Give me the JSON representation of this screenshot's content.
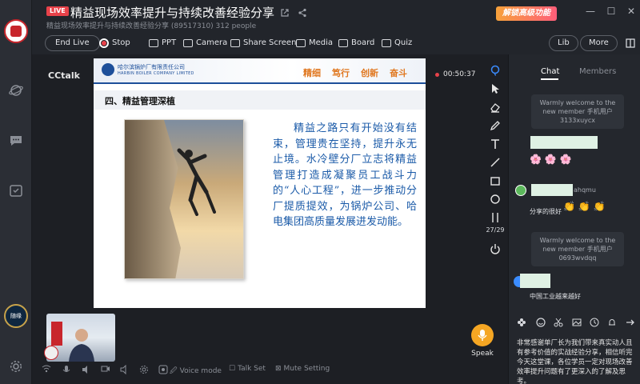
{
  "header": {
    "live_badge": "LIVE",
    "title": "精益现场效率提升与持续改善经验分享",
    "subtitle": "精益现场效率提升与持续改善经验分享 (89517310)   312 people",
    "unlock_label": "解锁高级功能"
  },
  "toolbar": {
    "end_live": "End Live",
    "stop": "Stop",
    "ppt": "PPT",
    "camera": "Camera",
    "share_screen": "Share Screen",
    "media": "Media",
    "board": "Board",
    "quiz": "Quiz",
    "lib": "Lib",
    "more": "More"
  },
  "stage": {
    "brand": "CCtalk",
    "timer": "00:50:37",
    "page_indicator": "27/29"
  },
  "slide": {
    "company_cn": "哈尔滨锅炉厂有限责任公司",
    "company_en": "HARBIN BOILER COMPANY LIMITED",
    "slogans": [
      "精细",
      "笃行",
      "创新",
      "奋斗"
    ],
    "section_title": "四、精益管理深植",
    "body": "精益之路只有开始没有结束，管理贵在坚持，提升永无止境。水冷壁分厂立志将精益管理打造成凝聚员工战斗力的“人心工程”，进一步推动分厂提质提效，为锅炉公司、哈电集团高质量发展进发动能。"
  },
  "chat": {
    "tab_chat": "Chat",
    "tab_members": "Members",
    "welcome_1": "Warmly welcome to the new member 手机用户3133xuycx",
    "flowers": "🌸 🌸 🌸",
    "user_2_suffix": "ahqmu",
    "msg_2": "分享的很好",
    "claps": "👏 👏 👏",
    "welcome_2": "Warmly welcome to the new member 手机用户0693wvdqq",
    "msg_3": "中国工业越来越好",
    "input_text": "非常感谢单厂长为我们带来真实动人且有参考价值的实战经验分享，相信听完今天这堂课，各位学员一定对现场改善效率提升问题有了更深入的了解及思考。"
  },
  "bottom": {
    "voice_mode": "Voice mode",
    "talk_set": "Talk Set",
    "mute_setting": "Mute Setting",
    "speak": "Speak"
  },
  "rail": {
    "user_badge": "随缘"
  }
}
